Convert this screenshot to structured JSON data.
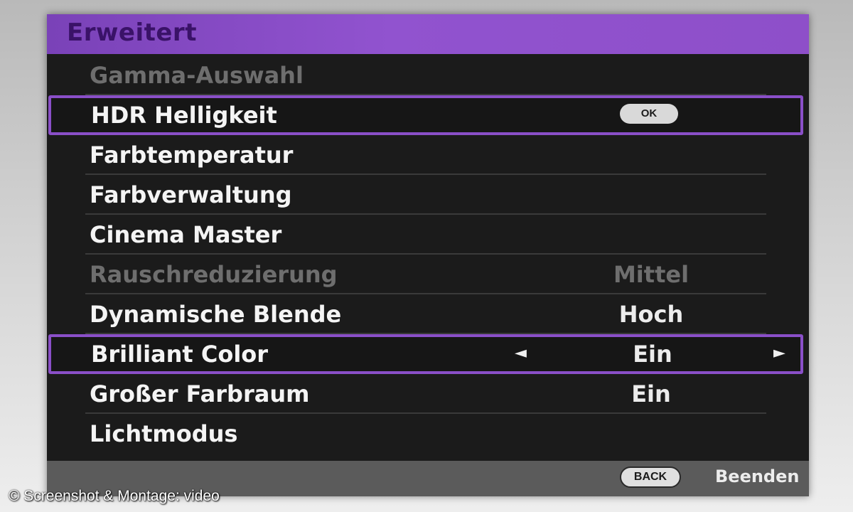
{
  "menu": {
    "title": "Erweitert",
    "items": [
      {
        "label": "Gamma-Auswahl",
        "value": "",
        "state": "disabled",
        "control": "none"
      },
      {
        "label": "HDR Helligkeit",
        "value": "",
        "state": "selected",
        "control": "ok",
        "button_label": "OK"
      },
      {
        "label": "Farbtemperatur",
        "value": "",
        "state": "normal",
        "control": "none"
      },
      {
        "label": "Farbverwaltung",
        "value": "",
        "state": "normal",
        "control": "none"
      },
      {
        "label": "Cinema Master",
        "value": "",
        "state": "normal",
        "control": "none"
      },
      {
        "label": "Rauschreduzierung",
        "value": "Mittel",
        "state": "disabled",
        "control": "value"
      },
      {
        "label": "Dynamische Blende",
        "value": "Hoch",
        "state": "normal",
        "control": "value"
      },
      {
        "label": "Brilliant Color",
        "value": "Ein",
        "state": "selected",
        "control": "arrows",
        "arrow_left": "◄",
        "arrow_right": "►"
      },
      {
        "label": "Großer Farbraum",
        "value": "Ein",
        "state": "normal",
        "control": "value"
      },
      {
        "label": "Lichtmodus",
        "value": "",
        "state": "normal",
        "control": "none"
      }
    ]
  },
  "footer": {
    "back_label": "BACK",
    "exit_label": "Beenden"
  },
  "copyright": "© Screenshot & Montage: video",
  "colors": {
    "accent_purple": "#8a4fc8",
    "header_purple": "#9153cf",
    "title_text": "#3a1268",
    "panel_bg": "#1b1b1b",
    "footer_bg": "#5b5b5b",
    "disabled_text": "#6e6e6e"
  }
}
